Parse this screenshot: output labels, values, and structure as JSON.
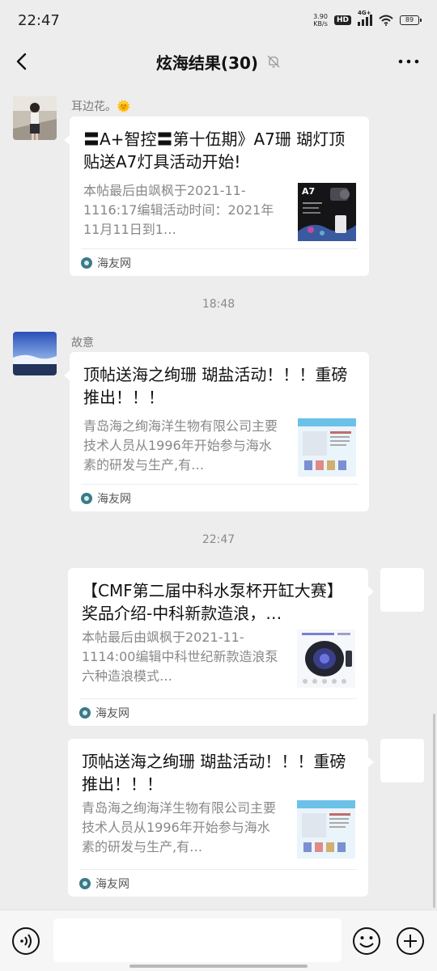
{
  "status_bar": {
    "time": "22:47",
    "net_speed_value": "3.90",
    "net_speed_unit": "KB/s",
    "hd": "HD",
    "network": "4G+",
    "battery": "89"
  },
  "header": {
    "title": "炫海结果(30)",
    "icons": [
      "back-icon",
      "muted-bell-icon",
      "more-icon"
    ]
  },
  "messages": [
    {
      "sender": "耳边花。🌞",
      "title": "〓A+智控〓第十伍期》A7珊 瑚灯顶贴送A7灯具活动开始!",
      "desc": "本帖最后由飒枫于2021-11-1116:17编辑活动时间：2021年11月11日到1…",
      "source": "海友网",
      "thumb_label": "A7"
    },
    {
      "time_divider": "18:48",
      "sender": "故意",
      "title": "顶帖送海之绚珊 瑚盐活动！！！重磅推出！！！",
      "desc": "青岛海之绚海洋生物有限公司主要技术人员从1996年开始参与海水素的研发与生产,有…",
      "source": "海友网"
    },
    {
      "time_divider": "22:47",
      "title": "【CMF第二届中科水泵杯开缸大赛】奖品介绍-中科新款造浪，…",
      "desc": "本帖最后由飒枫于2021-11-1114:00编辑中科世纪新款造浪泵六种造浪模式…",
      "source": "海友网"
    },
    {
      "title": "顶帖送海之绚珊 瑚盐活动！！！重磅推出！！！",
      "desc": "青岛海之绚海洋生物有限公司主要技术人员从1996年开始参与海水素的研发与生产,有…",
      "source": "海友网"
    }
  ],
  "input_bar": {
    "value": "",
    "icons": [
      "voice-icon",
      "emoji-icon",
      "plus-icon"
    ]
  }
}
